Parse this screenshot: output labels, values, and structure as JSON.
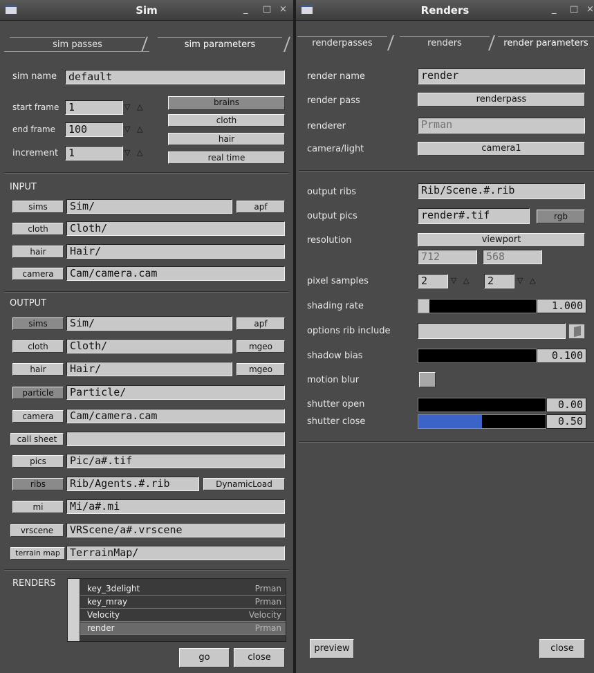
{
  "sim": {
    "title": "Sim",
    "window_controls": [
      "_",
      "□",
      "×"
    ],
    "tabs": [
      "sim passes",
      "sim parameters"
    ],
    "params": {
      "sim_name_label": "sim name",
      "sim_name_value": "default",
      "start_frame_label": "start frame",
      "start_frame_value": "1",
      "end_frame_label": "end frame",
      "end_frame_value": "100",
      "increment_label": "increment",
      "increment_value": "1",
      "spin_down": "▽",
      "spin_up": "△",
      "buttons": [
        "brains",
        "cloth",
        "hair",
        "real time"
      ]
    },
    "input": {
      "heading": "INPUT",
      "rows": [
        {
          "button": "sims",
          "value": "Sim/",
          "extra": "apf"
        },
        {
          "button": "cloth",
          "value": "Cloth/",
          "extra": ""
        },
        {
          "button": "hair",
          "value": "Hair/",
          "extra": ""
        },
        {
          "button": "camera",
          "value": "Cam/camera.cam",
          "extra": ""
        }
      ]
    },
    "output": {
      "heading": "OUTPUT",
      "rows": [
        {
          "button": "sims",
          "value": "Sim/",
          "extra": "apf"
        },
        {
          "button": "cloth",
          "value": "Cloth/",
          "extra": "mgeo"
        },
        {
          "button": "hair",
          "value": "Hair/",
          "extra": "mgeo"
        },
        {
          "button": "particle",
          "value": "Particle/",
          "extra": ""
        },
        {
          "button": "camera",
          "value": "Cam/camera.cam",
          "extra": ""
        },
        {
          "button": "call sheet",
          "value": "",
          "extra": ""
        },
        {
          "button": "pics",
          "value": "Pic/a#.tif",
          "extra": ""
        },
        {
          "button": "ribs",
          "value": "Rib/Agents.#.rib",
          "extra": "DynamicLoad"
        },
        {
          "button": "mi",
          "value": "Mi/a#.mi",
          "extra": ""
        },
        {
          "button": "vrscene",
          "value": "VRScene/a#.vrscene",
          "extra": ""
        },
        {
          "button": "terrain map",
          "value": "TerrainMap/",
          "extra": ""
        }
      ]
    },
    "renders": {
      "heading": "RENDERS",
      "items": [
        {
          "name": "key_3delight",
          "renderer": "Prman"
        },
        {
          "name": "key_mray",
          "renderer": "Prman"
        },
        {
          "name": "Velocity",
          "renderer": "Velocity"
        },
        {
          "name": "render",
          "renderer": "Prman"
        }
      ]
    },
    "go_label": "go",
    "close_label": "close"
  },
  "renders_win": {
    "title": "Renders",
    "window_controls": [
      "_",
      "□",
      "×"
    ],
    "tabs": [
      "renderpasses",
      "renders",
      "render parameters"
    ],
    "render_name_label": "render name",
    "render_name_value": "render",
    "render_pass_label": "render pass",
    "render_pass_value": "renderpass",
    "renderer_label": "renderer",
    "renderer_value": "Prman",
    "camera_label": "camera/light",
    "camera_value": "camera1",
    "output_ribs_label": "output ribs",
    "output_ribs_value": "Rib/Scene.#.rib",
    "output_pics_label": "output pics",
    "output_pics_value": "render#.tif",
    "rgb_label": "rgb",
    "resolution_label": "resolution",
    "resolution_value": "viewport",
    "res_x": "712",
    "res_y": "568",
    "pixel_samples_label": "pixel samples",
    "pixel_samples_x": "2",
    "pixel_samples_y": "2",
    "shading_rate_label": "shading rate",
    "shading_rate_value": "1.000",
    "options_rib_label": "options rib include",
    "shadow_bias_label": "shadow bias",
    "shadow_bias_value": "0.100",
    "motion_blur_label": "motion blur",
    "shutter_open_label": "shutter open",
    "shutter_open_value": "0.00",
    "shutter_close_label": "shutter close",
    "shutter_close_value": "0.50",
    "preview_label": "preview",
    "close_label": "close",
    "accent": "#3b63c8"
  }
}
